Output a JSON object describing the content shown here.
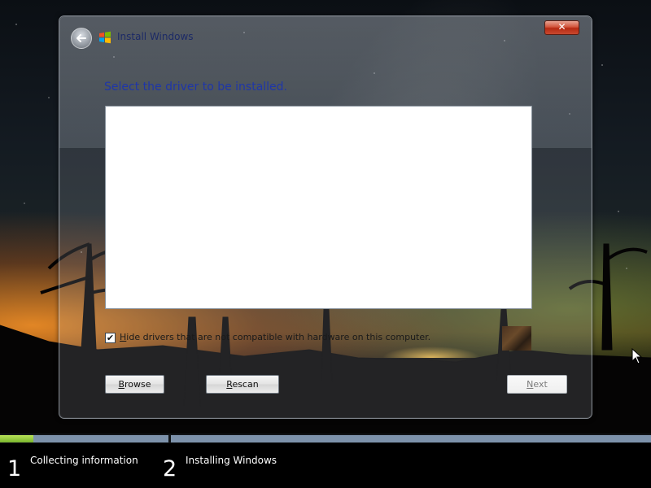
{
  "window": {
    "title": "Install Windows",
    "close_label": "✕"
  },
  "main": {
    "heading": "Select the driver to be installed.",
    "hide_incompatible": {
      "checked": true,
      "label_first": "H",
      "label_rest": "ide drivers that are not compatible with hardware on this computer."
    }
  },
  "buttons": {
    "browse": {
      "first": "B",
      "rest": "rowse"
    },
    "rescan": {
      "first": "R",
      "rest": "escan"
    },
    "next": {
      "first": "N",
      "rest": "ext",
      "enabled": false
    }
  },
  "progress": {
    "fraction": 0.2,
    "steps": [
      {
        "number": "1",
        "label": "Collecting information"
      },
      {
        "number": "2",
        "label": "Installing Windows"
      }
    ]
  },
  "icons": {
    "back": "back-arrow-icon",
    "logo": "windows-logo-icon",
    "checkmark": "✔"
  },
  "colors": {
    "heading": "#1f36a8",
    "progress_fill": "#8bc34a",
    "progress_track": "#7d92ab",
    "close_button": "#c9492f"
  }
}
